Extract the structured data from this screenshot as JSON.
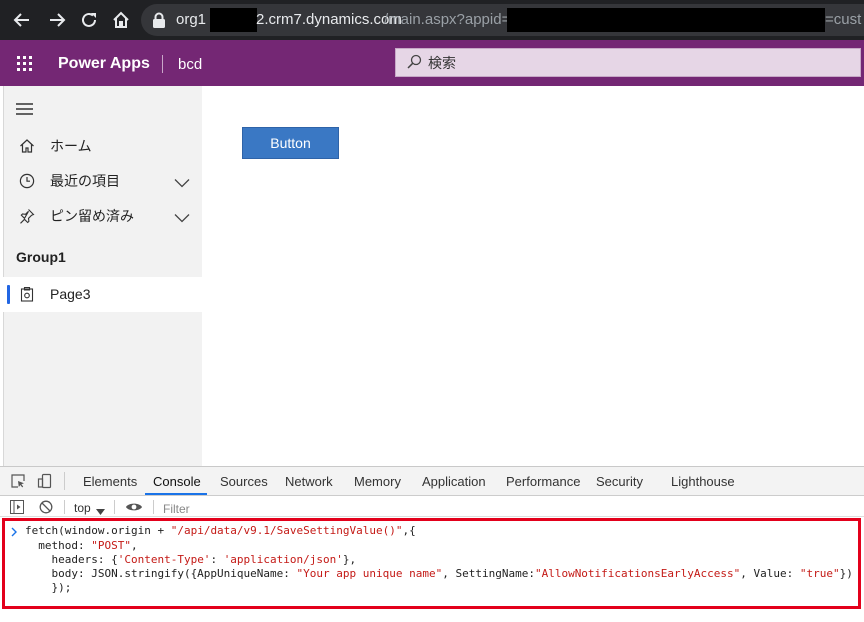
{
  "browser": {
    "url_host_prefix": "org1",
    "url_host_suffix": "2.crm7.dynamics.com",
    "url_path": "/main.aspx?appid=1",
    "url_tail": "=cust"
  },
  "header": {
    "app_title": "Power Apps",
    "app_name": "bcd",
    "search_placeholder": "検索",
    "color": "#742774"
  },
  "sidebar": {
    "items": [
      {
        "label": "ホーム",
        "icon": "home-icon"
      },
      {
        "label": "最近の項目",
        "icon": "clock-icon"
      },
      {
        "label": "ピン留め済み",
        "icon": "pin-icon"
      }
    ],
    "group_label": "Group1",
    "pages": [
      {
        "label": "Page3",
        "icon": "page-icon"
      }
    ]
  },
  "main": {
    "button_label": "Button"
  },
  "devtools": {
    "tabs": [
      "Elements",
      "Console",
      "Sources",
      "Network",
      "Memory",
      "Application",
      "Performance",
      "Security",
      "Lighthouse"
    ],
    "active_tab": "Console",
    "context": "top",
    "filter_placeholder": "Filter",
    "console_lines": [
      [
        "fetch(window.origin + ",
        "\"/api/data/v9.1/SaveSettingValue()\"",
        ",{"
      ],
      [
        "  method: ",
        "\"POST\"",
        ","
      ],
      [
        "    headers: {",
        "'Content-Type'",
        ": ",
        "'application/json'",
        "},"
      ],
      [
        "    body: JSON.stringify({AppUniqueName: ",
        "\"Your app unique name\"",
        ", SettingName:",
        "\"AllowNotificationsEarlyAccess\"",
        ", Value: ",
        "\"true\"",
        "})"
      ],
      [
        "    });"
      ]
    ]
  }
}
